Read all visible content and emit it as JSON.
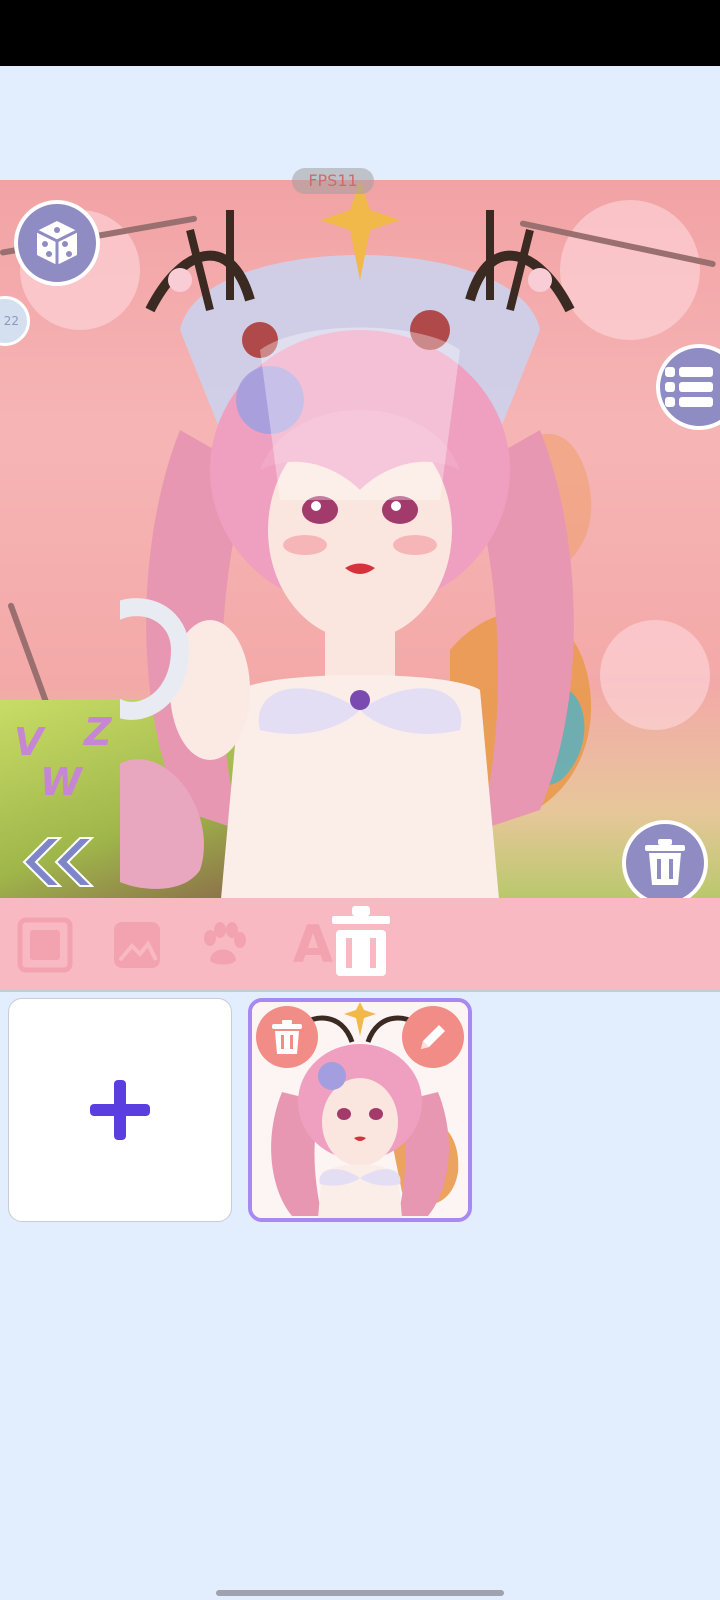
{
  "status_bar": {
    "background": "#000000"
  },
  "canvas": {
    "fps_label": "FPS11",
    "side_tag_label": "22",
    "decor_letters": [
      "V",
      "W",
      "Z"
    ]
  },
  "buttons": {
    "randomize_icon": "dice-icon",
    "layers_icon": "list-icon",
    "delete_icon": "trash-icon",
    "collapse_icon": "double-chevron-left-icon"
  },
  "toolbar": {
    "items": [
      {
        "icon": "background-frame-icon"
      },
      {
        "icon": "image-icon"
      },
      {
        "icon": "paw-icon"
      },
      {
        "icon": "text-icon",
        "label": "A"
      },
      {
        "icon": "trash-icon"
      }
    ],
    "background": "#f8b9c2"
  },
  "saved_slots": {
    "add_icon": "plus-icon",
    "slot_actions": [
      "trash-icon",
      "pencil-icon"
    ]
  },
  "colors": {
    "accent": "#a889f2",
    "plus": "#5b3ee0",
    "button": "#8f8cc4",
    "slot_action": "#f18d86",
    "page_bg": "#e2edfd"
  }
}
